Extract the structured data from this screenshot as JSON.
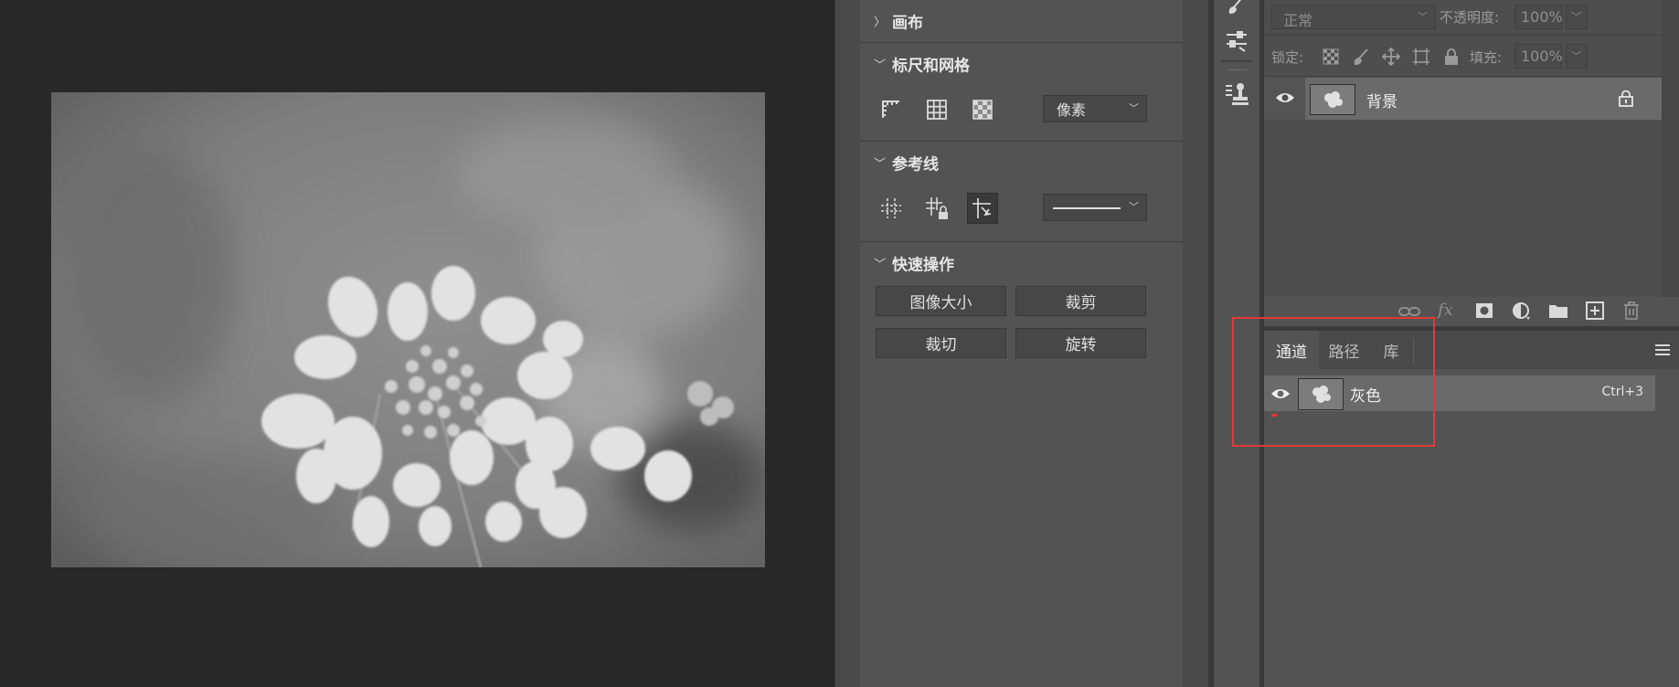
{
  "properties": {
    "sections": [
      {
        "id": "canvas",
        "title": "画布",
        "collapsed": true
      },
      {
        "id": "rulers",
        "title": "标尺和网格",
        "collapsed": false
      },
      {
        "id": "guides",
        "title": "参考线",
        "collapsed": false
      },
      {
        "id": "quick",
        "title": "快速操作",
        "collapsed": false
      }
    ],
    "unit_select": "像素",
    "quick_actions": [
      "图像大小",
      "裁剪",
      "裁切",
      "旋转"
    ]
  },
  "layers": {
    "blend_mode": "正常",
    "opacity_label": "不透明度:",
    "opacity_value": "100%",
    "lock_label": "锁定:",
    "fill_label": "填充:",
    "fill_value": "100%",
    "items": [
      {
        "name": "背景",
        "visible": true,
        "locked": true
      }
    ]
  },
  "channels": {
    "tabs": [
      "通道",
      "路径",
      "库"
    ],
    "active_tab": "通道",
    "items": [
      {
        "name": "灰色",
        "shortcut": "Ctrl+3",
        "visible": true
      }
    ]
  },
  "colors": {
    "highlight": "#e23a35",
    "panel": "#535353",
    "canvas": "#282828"
  }
}
